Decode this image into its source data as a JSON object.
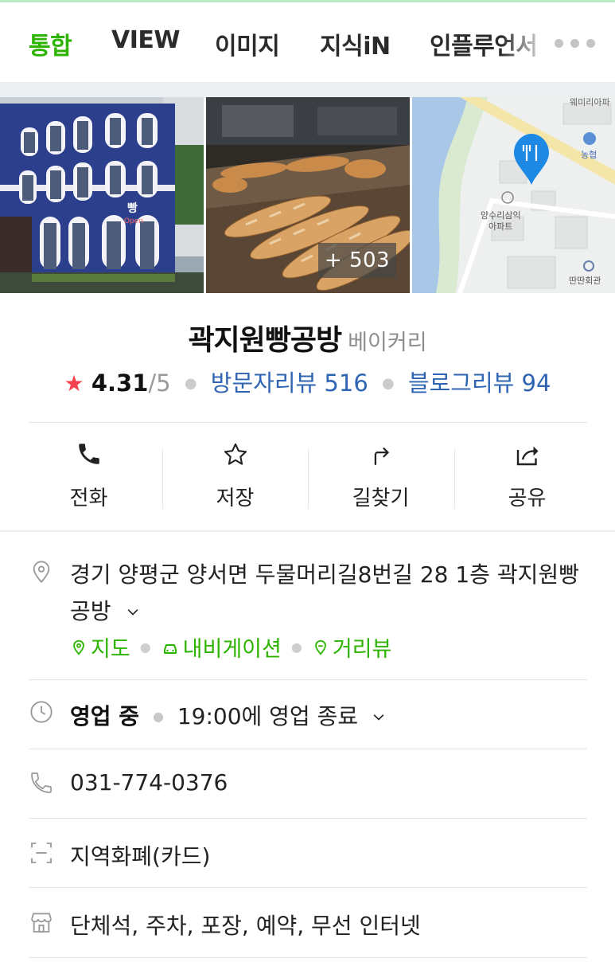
{
  "tabs": [
    {
      "label": "통합",
      "active": true
    },
    {
      "label": "VIEW"
    },
    {
      "label": "이미지"
    },
    {
      "label": "지식iN"
    },
    {
      "label": "인플루언서"
    }
  ],
  "photos": {
    "more_count": "+ 503",
    "map_labels": {
      "top": "웨미리아파",
      "bank": "농협",
      "apartment_line1": "양수리삼익",
      "apartment_line2": "아파트",
      "hall": "딴딴회관",
      "sign": "빵",
      "sign_small": "Open"
    }
  },
  "place": {
    "name": "곽지원빵공방",
    "category": "베이커리",
    "rating": "4.31",
    "rating_max": "/5",
    "visitor_reviews_label": "방문자리뷰 516",
    "blog_reviews_label": "블로그리뷰 94"
  },
  "actions": [
    {
      "label": "전화",
      "icon": "phone-icon"
    },
    {
      "label": "저장",
      "icon": "star-outline-icon"
    },
    {
      "label": "길찾기",
      "icon": "directions-icon"
    },
    {
      "label": "공유",
      "icon": "share-icon"
    }
  ],
  "info": {
    "address_line1": "경기 양평군 양서면 두물머리길8번길 28 1층 곽지원빵",
    "address_line2": "공방",
    "links": [
      "지도",
      "내비게이션",
      "거리뷰"
    ],
    "hours_status": "영업 중",
    "hours_detail": "19:00에 영업 종료",
    "phone": "031-774-0376",
    "payment": "지역화폐(카드)",
    "amenities": "단체석, 주차, 포장, 예약, 무선 인터넷"
  },
  "colors": {
    "accent_green": "#2db400",
    "link_blue": "#2f64b3",
    "star_red": "#f6404f",
    "map_pin_blue": "#1e88e5"
  }
}
